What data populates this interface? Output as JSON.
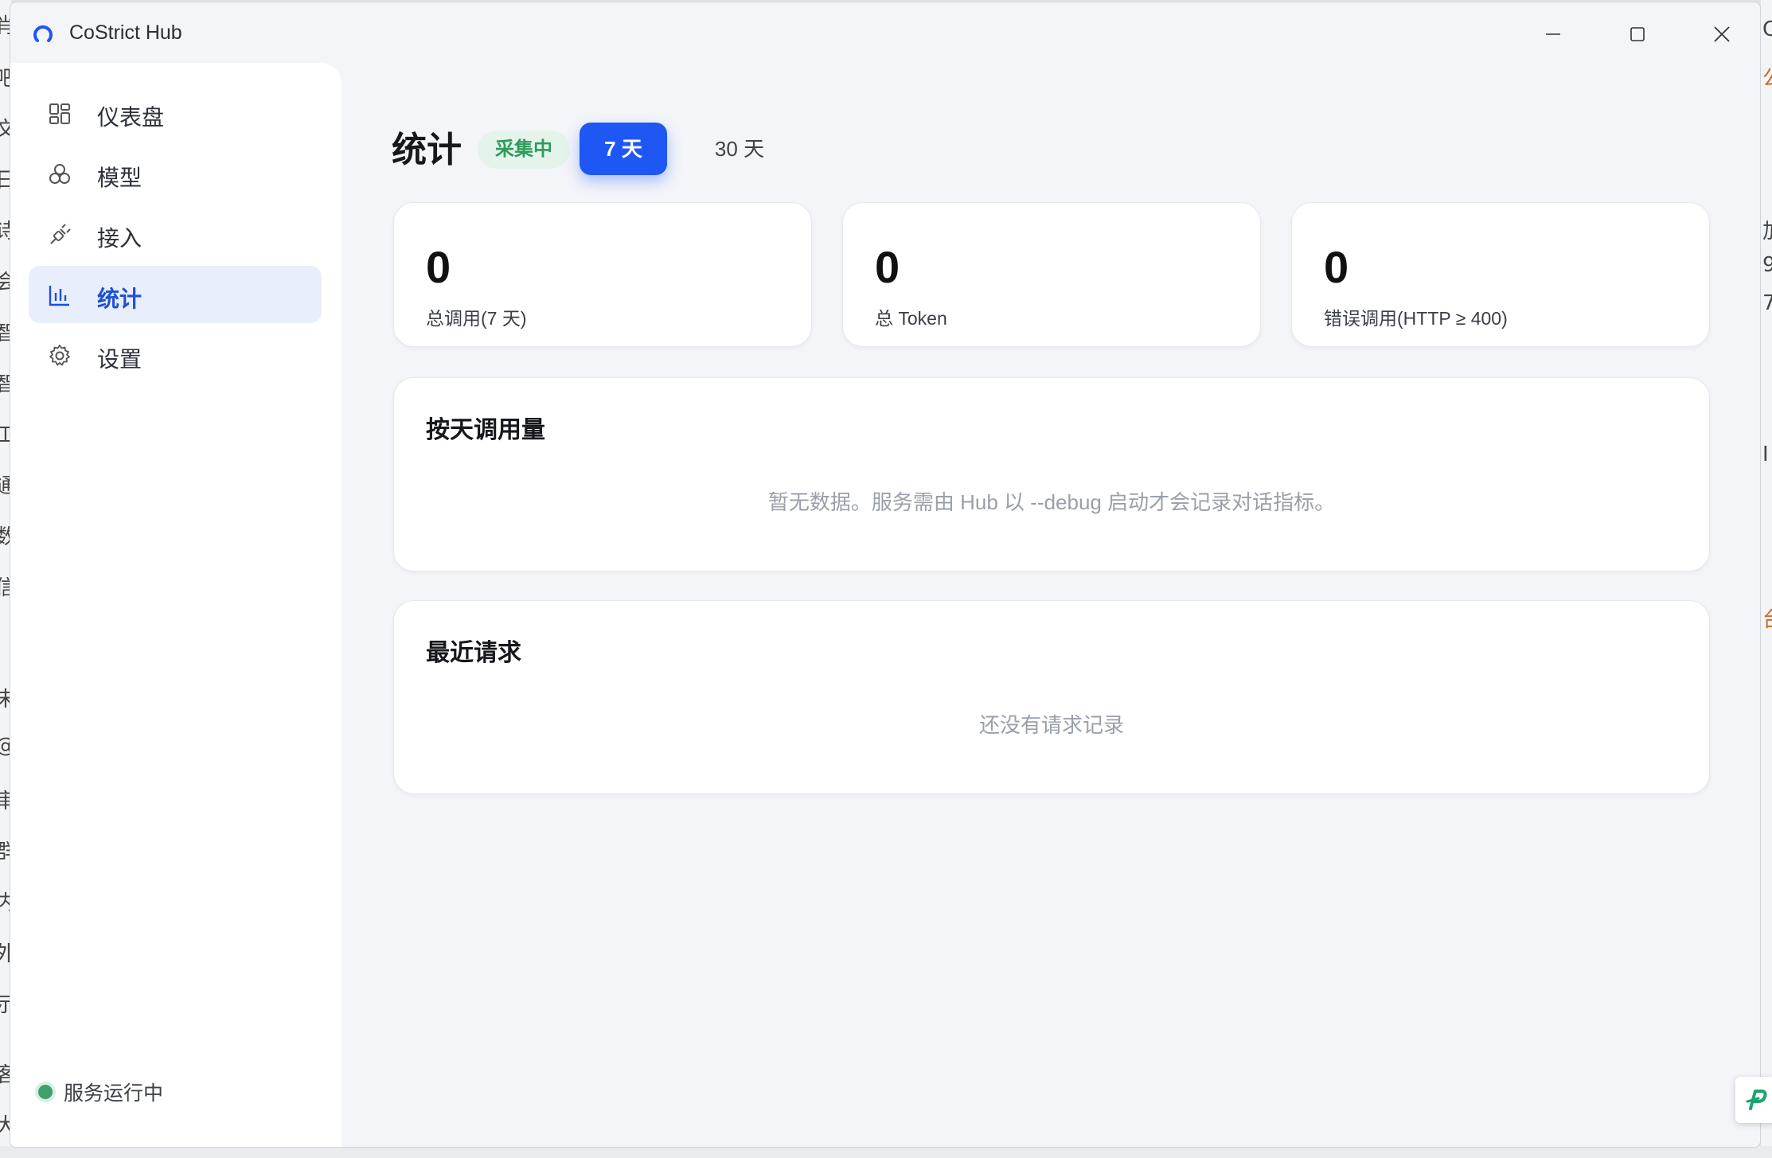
{
  "window": {
    "title": "CoStrict Hub"
  },
  "sidebar": {
    "items": [
      {
        "label": "仪表盘",
        "icon": "dashboard-icon"
      },
      {
        "label": "模型",
        "icon": "models-icon"
      },
      {
        "label": "接入",
        "icon": "plug-icon"
      },
      {
        "label": "统计",
        "icon": "bar-chart-icon",
        "active": true
      },
      {
        "label": "设置",
        "icon": "gear-icon"
      }
    ],
    "status_label": "服务运行中"
  },
  "header": {
    "title": "统计",
    "badge": "采集中",
    "range_options": [
      "7 天",
      "30 天"
    ],
    "selected_range": "7 天"
  },
  "stats": [
    {
      "value": "0",
      "label": "总调用(7 天)"
    },
    {
      "value": "0",
      "label": "总 Token"
    },
    {
      "value": "0",
      "label": "错误调用(HTTP ≥ 400)"
    }
  ],
  "daily_usage": {
    "title": "按天调用量",
    "empty_text": "暂无数据。服务需由 Hub 以 --debug 启动才会记录对话指标。"
  },
  "recent_requests": {
    "title": "最近请求",
    "empty_text": "还没有请求记录"
  },
  "colors": {
    "accent": "#1f57f5",
    "active_nav_bg": "#e8eefc",
    "status_green": "#3fa06a",
    "badge_bg": "#e4f4ea",
    "badge_text": "#2f9a5b"
  }
}
